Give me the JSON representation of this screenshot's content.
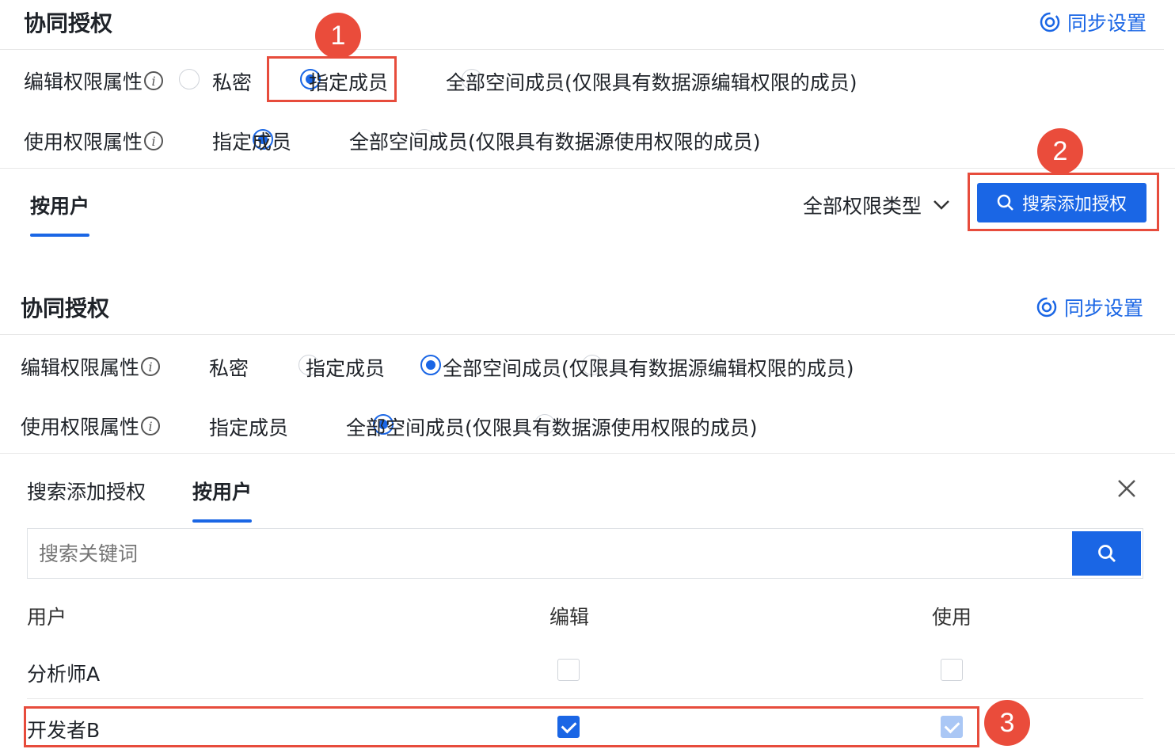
{
  "panel1": {
    "title": "协同授权",
    "sync_label": "同步设置",
    "edit_label": "编辑权限属性",
    "edit_options": [
      "私密",
      "指定成员",
      "全部空间成员(仅限具有数据源编辑权限的成员)"
    ],
    "use_label": "使用权限属性",
    "use_options": [
      "指定成员",
      "全部空间成员(仅限具有数据源使用权限的成员)"
    ],
    "tab_by_user": "按用户",
    "filter_label": "全部权限类型",
    "search_add_button": "搜索添加授权"
  },
  "panel2": {
    "title": "协同授权",
    "sync_label": "同步设置",
    "edit_label": "编辑权限属性",
    "edit_options": [
      "私密",
      "指定成员",
      "全部空间成员(仅限具有数据源编辑权限的成员)"
    ],
    "use_label": "使用权限属性",
    "use_options": [
      "指定成员",
      "全部空间成员(仅限具有数据源使用权限的成员)"
    ],
    "tabs": [
      "搜索添加授权",
      "按用户"
    ],
    "search_placeholder": "搜索关键词",
    "table": {
      "headers": [
        "用户",
        "编辑",
        "使用"
      ],
      "rows": [
        {
          "user": "分析师A",
          "edit": false,
          "use": false
        },
        {
          "user": "开发者B",
          "edit": true,
          "use": true
        }
      ]
    }
  },
  "annotations": [
    "1",
    "2",
    "3"
  ],
  "colors": {
    "accent": "#1a66e5",
    "highlight": "#e74c3c"
  }
}
